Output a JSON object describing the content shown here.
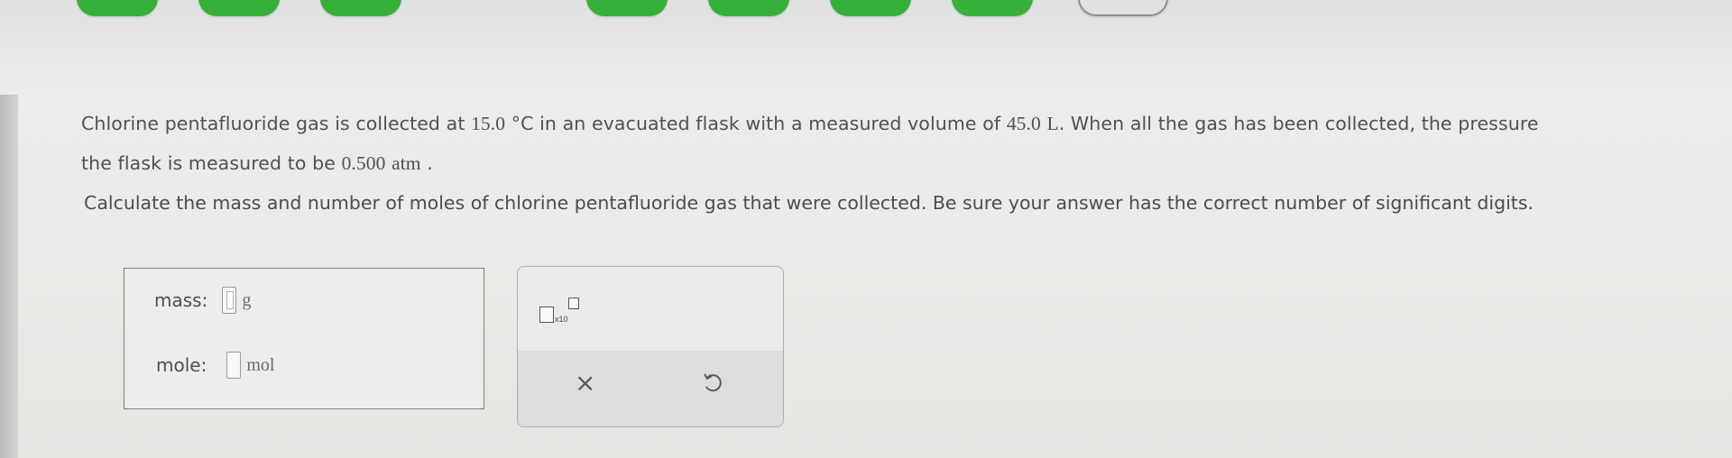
{
  "top_nav": {
    "progress_buttons": [
      "completed",
      "completed",
      "completed",
      "completed",
      "completed",
      "completed",
      "current"
    ],
    "colors": {
      "completed": "#37b03a",
      "current_border": "#8e9090"
    }
  },
  "question": {
    "line1_a": "Chlorine pentafluoride gas is collected at ",
    "temp_value": "15.0",
    "temp_unit": "°C",
    "line1_b": " in an evacuated flask with a measured volume of ",
    "volume_value": "45.0",
    "volume_unit": "L",
    "line1_c": ". When all the gas has been collected, the pressure",
    "line2_a": "the flask is measured to be ",
    "pressure_value": "0.500",
    "pressure_unit": "atm",
    "line2_b": " .",
    "instruction": "Calculate the mass and number of moles of chlorine pentafluoride gas that were collected. Be sure your answer has the correct number of significant digits."
  },
  "answer": {
    "mass_label": "mass:",
    "mass_value": "",
    "mass_unit": "g",
    "mole_label": "mole:",
    "mole_value": "",
    "mole_unit": "mol"
  },
  "tools": {
    "sci_notation_label": "x10",
    "clear_symbol": "×",
    "undo_icon": "undo-icon"
  }
}
